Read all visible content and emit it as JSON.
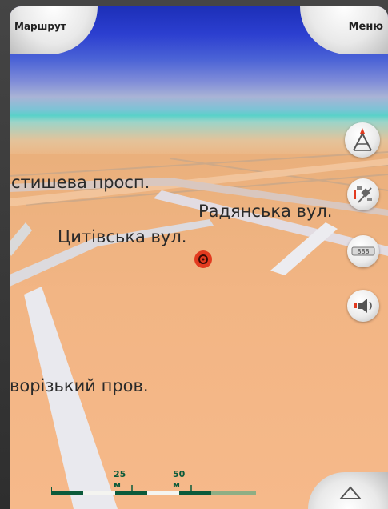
{
  "topbar": {
    "left_label": "Маршрут",
    "right_label": "Меню"
  },
  "streets": [
    "стишева просп.",
    "Радянська вул.",
    "Цитівська вул.",
    "ворізький пров."
  ],
  "scale": {
    "label_25": "25 м",
    "label_50": "50 м"
  },
  "side_buttons": [
    "compass-icon",
    "satellite-signal-icon",
    "speed-icon",
    "volume-icon"
  ],
  "colors": {
    "sky_top": "#1c2fb8",
    "ground": "#f0b07a",
    "road": "#e8e8ee",
    "position_marker": "#e23a1f",
    "scalebar": "#0b5a3a"
  }
}
